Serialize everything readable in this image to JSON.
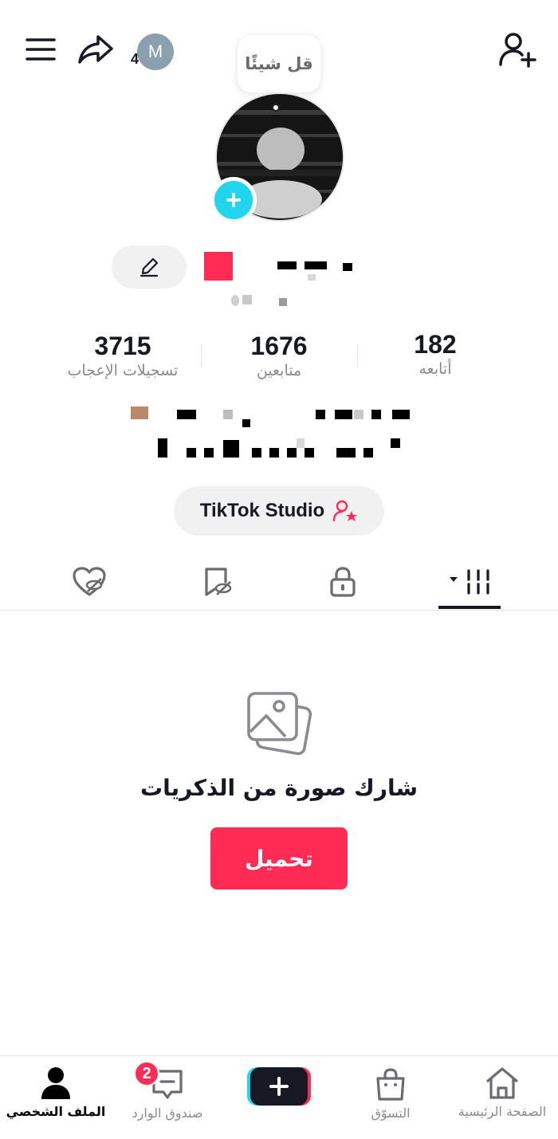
{
  "header": {
    "menu_icon": "hamburger-icon",
    "share_icon": "share-arrow-icon",
    "account_initial": "M",
    "account_count": "4",
    "add_friend_icon": "add-friend-icon",
    "say_something": "قل شيئًا"
  },
  "profile": {
    "avatar_add_symbol": "+",
    "edit_icon": "pencil-icon"
  },
  "stats": {
    "likes": {
      "value": "3715",
      "label": "تسجيلات الإعجاب"
    },
    "followers": {
      "value": "1676",
      "label": "متابعين"
    },
    "following": {
      "value": "182",
      "label": "أتابعه"
    }
  },
  "studio": {
    "label": "TikTok Studio",
    "icon": "creator-star-icon"
  },
  "tabs": [
    {
      "name": "liked",
      "icon": "hidden-heart-icon"
    },
    {
      "name": "favorites",
      "icon": "hidden-bookmark-icon"
    },
    {
      "name": "private",
      "icon": "lock-icon"
    },
    {
      "name": "videos",
      "icon": "grid-icon",
      "active": true
    }
  ],
  "empty_state": {
    "icon": "photo-stack-icon",
    "title": "شارك صورة من الذكريات",
    "button": "تحميل"
  },
  "bottom_nav": {
    "profile": "الملف الشخصي",
    "inbox": "صندوق الوارد",
    "inbox_badge": "2",
    "create": "+",
    "shop": "التسوّق",
    "home": "الصفحة الرئيسية"
  },
  "colors": {
    "accent": "#fe2c55",
    "cyan": "#20d5ec",
    "text": "#161823",
    "muted": "#8a8b91"
  }
}
